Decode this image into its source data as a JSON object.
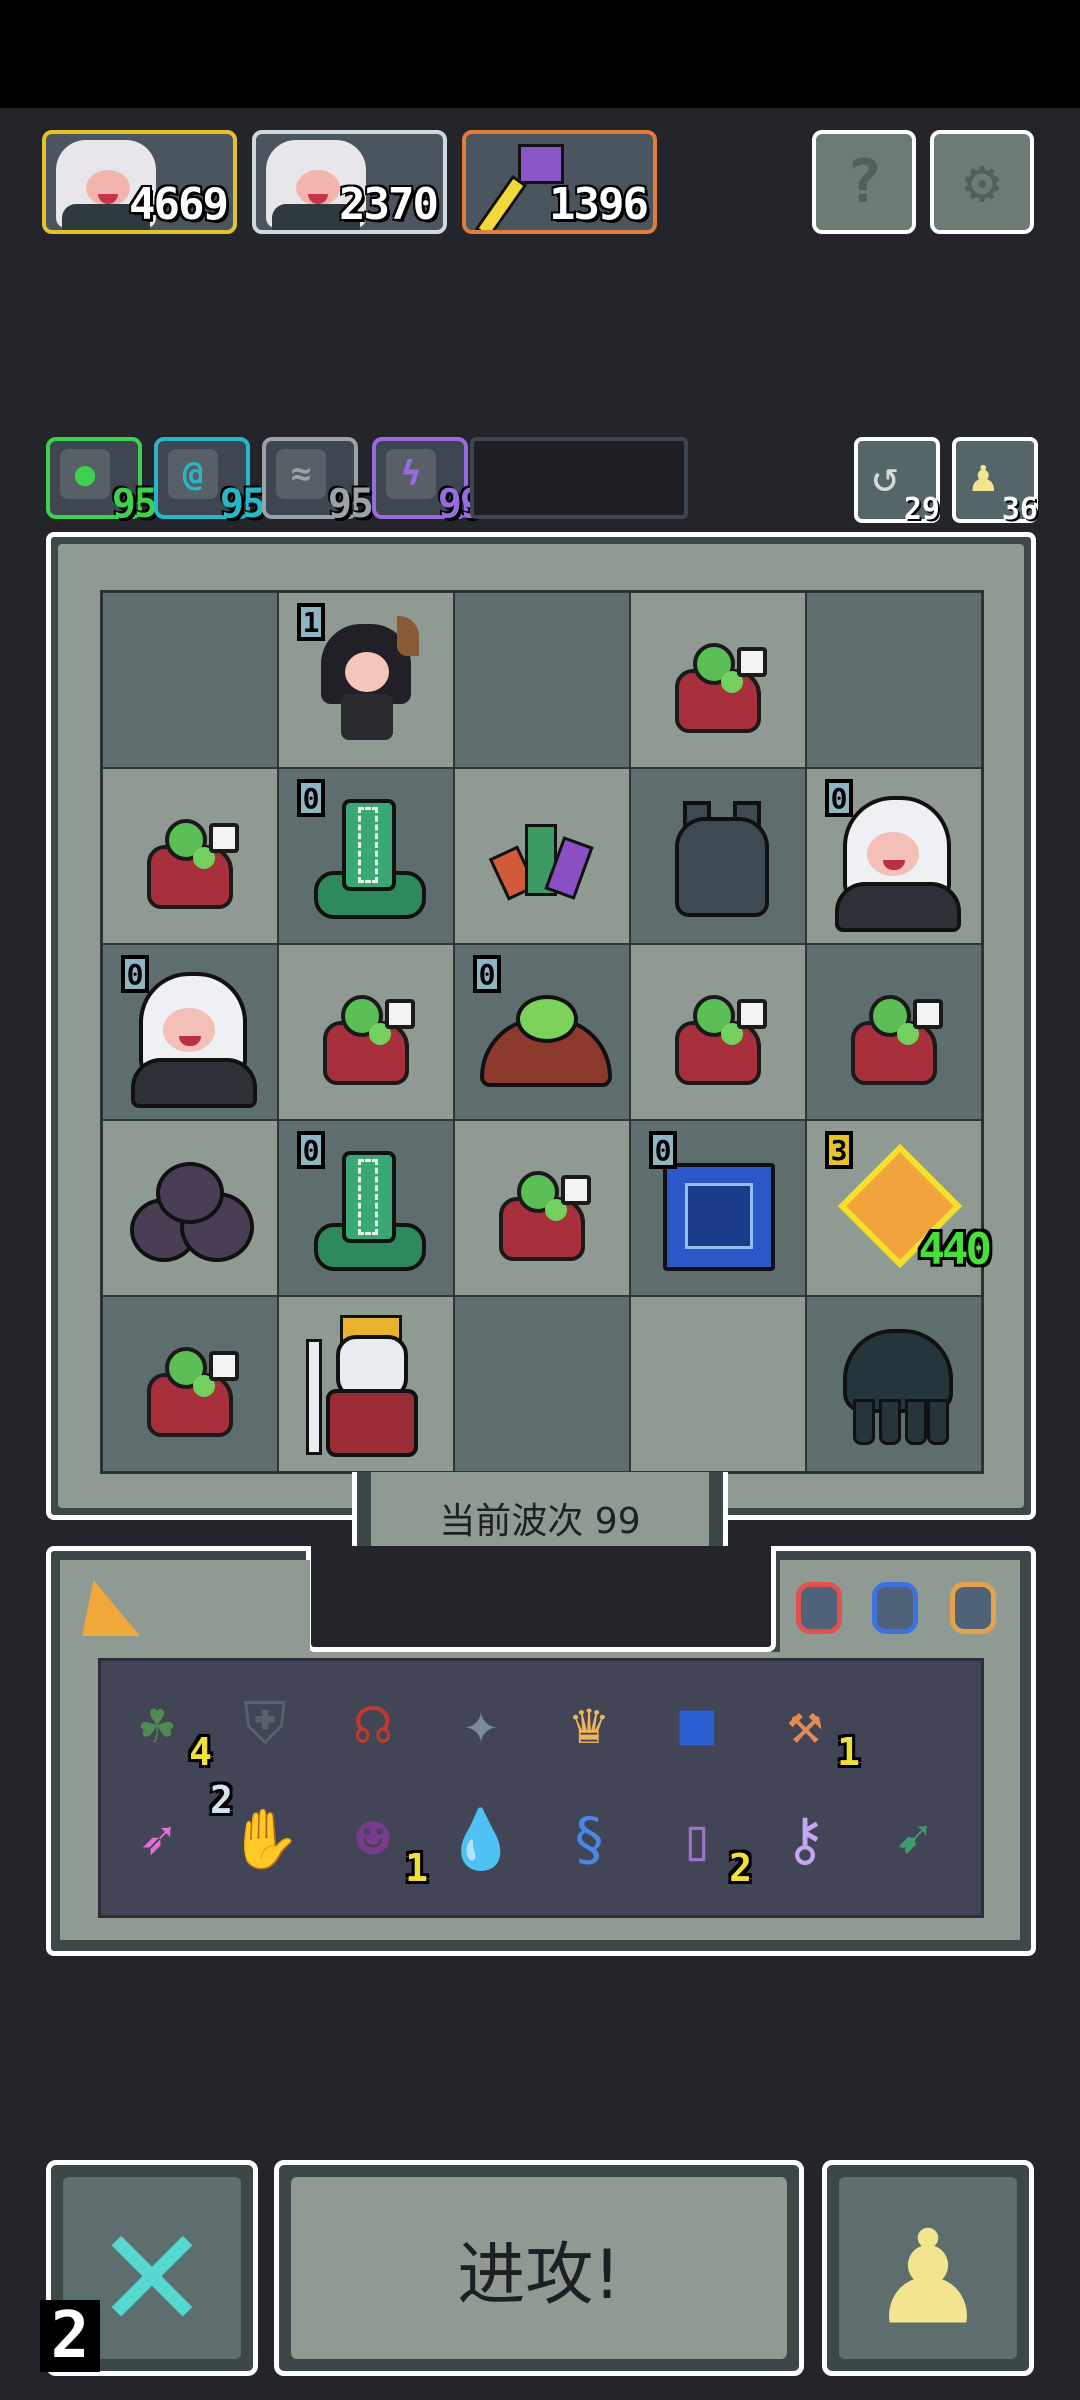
{
  "top_cards": [
    {
      "value": "4669",
      "border": "#e6c22a"
    },
    {
      "value": "2370",
      "border": "#cfd8dc"
    },
    {
      "value": "1396",
      "border": "#e07d3c"
    }
  ],
  "top_buttons": [
    {
      "glyph": "?",
      "icon": "help-icon"
    },
    {
      "glyph": "⚙",
      "icon": "settings-icon"
    }
  ],
  "chips": [
    {
      "value": "95",
      "color": "#3ed14e",
      "glyph": "●"
    },
    {
      "value": "95",
      "color": "#27b8c8",
      "glyph": "@"
    },
    {
      "value": "95",
      "color": "#9aa3a7",
      "glyph": "≈"
    },
    {
      "value": "99",
      "color": "#9a6ae0",
      "glyph": "ϟ"
    }
  ],
  "reroll": {
    "value": "29",
    "glyph": "↺"
  },
  "removal": {
    "value": "36",
    "glyph": "♟"
  },
  "board": {
    "cells": [
      {
        "sprite": "none",
        "level": "",
        "count": ""
      },
      {
        "sprite": "dark-girl",
        "level": "1",
        "count": ""
      },
      {
        "sprite": "none",
        "level": "",
        "count": ""
      },
      {
        "sprite": "root",
        "level": "",
        "count": ""
      },
      {
        "sprite": "none",
        "level": "",
        "count": ""
      },
      {
        "sprite": "root",
        "level": "",
        "count": ""
      },
      {
        "sprite": "cactus",
        "level": "0",
        "count": ""
      },
      {
        "sprite": "crystal",
        "level": "",
        "count": ""
      },
      {
        "sprite": "gargoyle",
        "level": "",
        "count": ""
      },
      {
        "sprite": "girl",
        "level": "0",
        "count": ""
      },
      {
        "sprite": "girl",
        "level": "0",
        "count": ""
      },
      {
        "sprite": "root",
        "level": "",
        "count": ""
      },
      {
        "sprite": "mound",
        "level": "0",
        "count": ""
      },
      {
        "sprite": "root",
        "level": "",
        "count": ""
      },
      {
        "sprite": "root",
        "level": "",
        "count": ""
      },
      {
        "sprite": "rock",
        "level": "",
        "count": ""
      },
      {
        "sprite": "cactus",
        "level": "0",
        "count": ""
      },
      {
        "sprite": "root",
        "level": "",
        "count": ""
      },
      {
        "sprite": "shrine",
        "level": "0",
        "count": ""
      },
      {
        "sprite": "gem",
        "level": "3",
        "count": "440"
      },
      {
        "sprite": "root",
        "level": "",
        "count": ""
      },
      {
        "sprite": "knight",
        "level": "",
        "count": ""
      },
      {
        "sprite": "none",
        "level": "",
        "count": ""
      },
      {
        "sprite": "none",
        "level": "",
        "count": ""
      },
      {
        "sprite": "squid",
        "level": "",
        "count": ""
      }
    ]
  },
  "wave_label": "当前波次 99",
  "inventory": {
    "items_row1": [
      {
        "icon": "goblin-icon",
        "glyph": "☘",
        "color": "#4f8a52",
        "qty": "4",
        "lvl": ""
      },
      {
        "icon": "shield-icon",
        "glyph": "⛨",
        "color": "#56636a",
        "qty": "",
        "lvl": ""
      },
      {
        "icon": "crab-icon",
        "glyph": "☊",
        "color": "#c0392b",
        "qty": "",
        "lvl": ""
      },
      {
        "icon": "shuriken-icon",
        "glyph": "✦",
        "color": "#7c8c94",
        "qty": "",
        "lvl": ""
      },
      {
        "icon": "crown-claw-icon",
        "glyph": "♛",
        "color": "#f0b55a",
        "qty": "",
        "lvl": ""
      },
      {
        "icon": "water-tile-icon",
        "glyph": "■",
        "color": "#2c5fd1",
        "qty": "",
        "lvl": ""
      },
      {
        "icon": "axe-icon",
        "glyph": "⚒",
        "color": "#e58a54",
        "qty": "1",
        "lvl": ""
      }
    ],
    "items_row2": [
      {
        "icon": "pink-arrow-icon",
        "glyph": "➶",
        "color": "#e36fd6",
        "qty": "",
        "lvl": ""
      },
      {
        "icon": "palm-icon",
        "glyph": "✋",
        "color": "#f1c7bf",
        "qty": "",
        "lvl": "2"
      },
      {
        "icon": "demon-mask-icon",
        "glyph": "☻",
        "color": "#7a3a8f",
        "qty": "1",
        "lvl": ""
      },
      {
        "icon": "water-drop-icon",
        "glyph": "💧",
        "color": "#3b7fe0",
        "qty": "",
        "lvl": ""
      },
      {
        "icon": "blue-bird-icon",
        "glyph": "§",
        "color": "#4b87e6",
        "qty": "",
        "lvl": ""
      },
      {
        "icon": "potion-jar-icon",
        "glyph": "▯",
        "color": "#9c73c8",
        "qty": "2",
        "lvl": ""
      },
      {
        "icon": "purple-key-icon",
        "glyph": "⚷",
        "color": "#c6a6f0",
        "qty": "",
        "lvl": ""
      },
      {
        "icon": "green-arrow-icon",
        "glyph": "➹",
        "color": "#3f9a6e",
        "qty": "",
        "lvl": ""
      }
    ],
    "tools": [
      {
        "icon": "ring-red-icon",
        "color": "#e25050"
      },
      {
        "icon": "ring-blue-icon",
        "color": "#3c73e0"
      },
      {
        "icon": "ring-orange-icon",
        "color": "#e6a24a"
      }
    ]
  },
  "bottom": {
    "attack_label": "进攻!",
    "speed": "2",
    "cancel_color": "#55d8d0",
    "pawn_color": "#f3e58f"
  }
}
